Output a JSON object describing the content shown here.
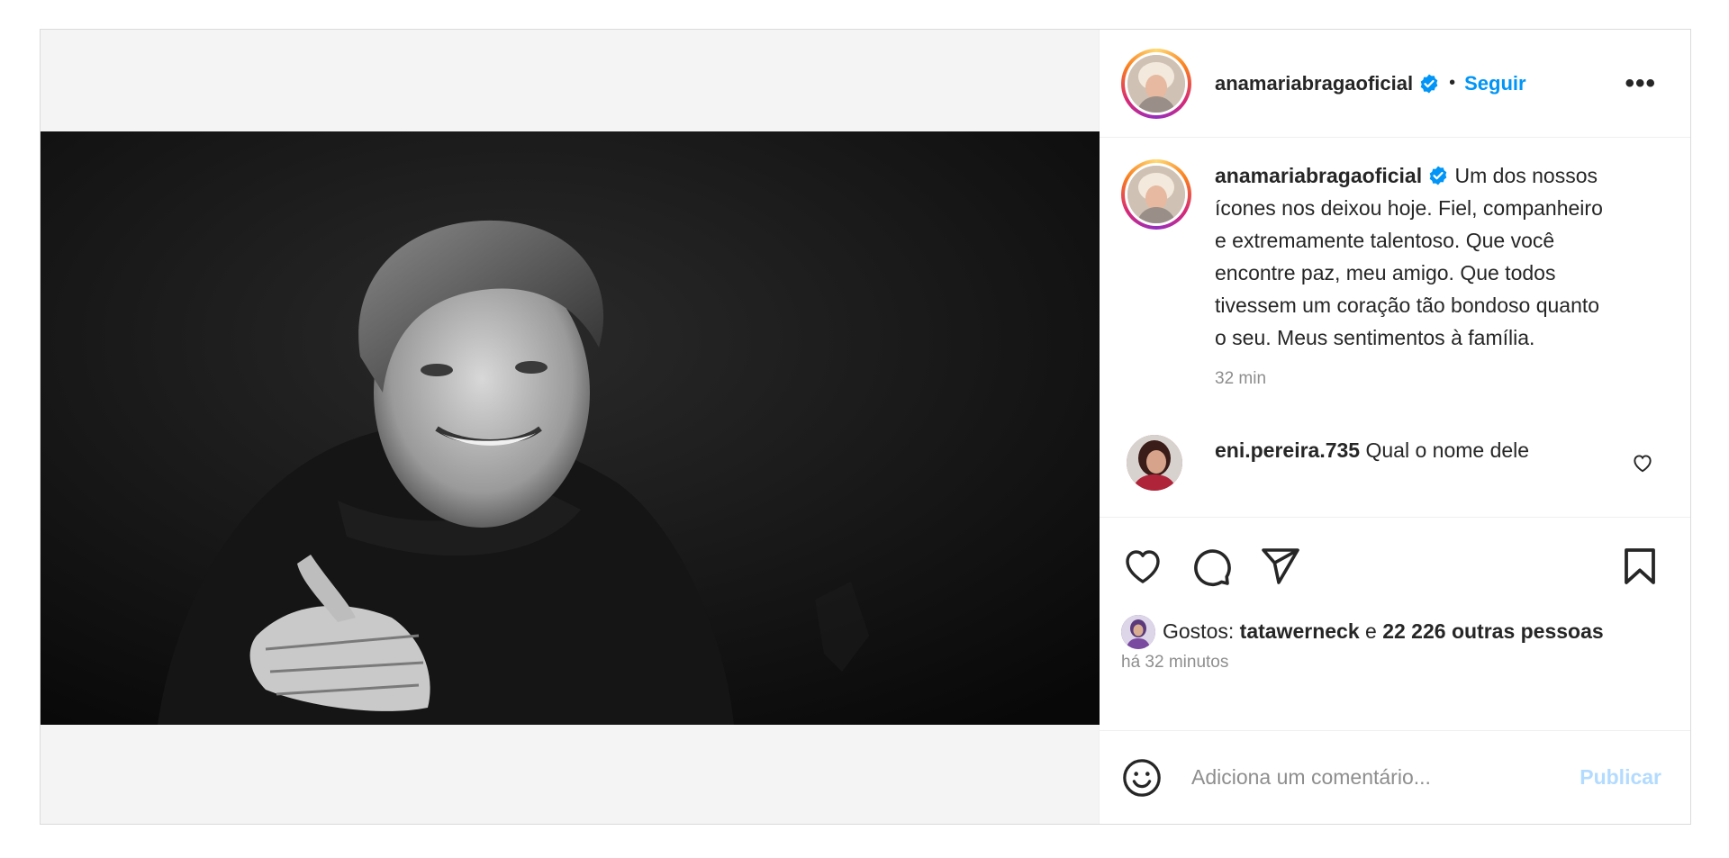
{
  "post": {
    "author": {
      "username": "anamariabragaoficial",
      "verified": true,
      "follow_label": "Seguir",
      "separator": "•",
      "more_label": "•••"
    },
    "caption": {
      "username": "anamariabragaoficial",
      "text": "Um dos nossos ícones nos deixou hoje. Fiel, companheiro e extremamente talentoso. Que você encontre paz, meu amigo. Que todos tivessem um coração tão bondoso quanto o seu. Meus sentimentos à família.",
      "time": "32 min"
    },
    "comments": [
      {
        "username": "eni.pereira.735",
        "text": "Qual o nome dele"
      }
    ],
    "likes": {
      "prefix": "Gostos: ",
      "first_liker": "tatawerneck",
      "connector": " e ",
      "others": "22 226 outras pessoas"
    },
    "posted_ago": "há 32 minutos",
    "composer": {
      "placeholder": "Adiciona um comentário...",
      "publish_label": "Publicar"
    }
  },
  "colors": {
    "accent": "#0095f6",
    "publish_disabled": "#b3dbff",
    "secondary_text": "#8e8e8e",
    "border": "#dbdbdb"
  },
  "icons": [
    "verified-icon",
    "more-icon",
    "heart-icon",
    "comment-icon",
    "share-icon",
    "bookmark-icon",
    "emoji-icon"
  ]
}
